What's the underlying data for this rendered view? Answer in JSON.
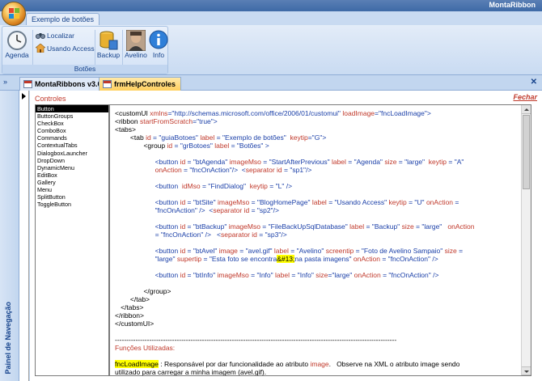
{
  "window": {
    "title": "MontaRibbon"
  },
  "ribbon": {
    "tab_label": "Exemplo de botões",
    "group_label": "Botões",
    "buttons": {
      "agenda": "Agenda",
      "localizar": "Localizar",
      "usando_access": "Usando Access",
      "backup": "Backup",
      "avelino": "Avelino",
      "info": "Info"
    }
  },
  "doc_tabs": {
    "tab1": "MontaRibbons v3.0",
    "tab2": "frmHelpControles"
  },
  "nav_pane": {
    "label": "Painel de Navegação",
    "toggle": "»"
  },
  "form": {
    "controls_title": "Controles",
    "close_link": "Fechar",
    "controls": [
      "Button",
      "ButtonGroups",
      "CheckBox",
      "ComboBox",
      "Commands",
      "ContextualTabs",
      "DialogboxLauncher",
      "DropDown",
      "DynamicMenu",
      "EditBox",
      "Gallery",
      "Menu",
      "SplitButton",
      "ToggleButton"
    ],
    "selected_control": "Button"
  },
  "code": {
    "l1": {
      "a": "<customUI ",
      "b": "xmlns",
      "c": "=\"http://schemas.microsoft.com/office/2006/01/customui\" ",
      "d": "loadImage",
      "e": "=\"fncLoadImage\">"
    },
    "l2": {
      "a": "<ribbon ",
      "b": "startFromScratch",
      "c": "=\"true\">"
    },
    "l3": "<tabs>",
    "l4": {
      "a": "<tab ",
      "b": "id",
      "c": " = \"guiaBotoes\" ",
      "d": "label",
      "e": " = \"Exemplo de botões\"  ",
      "f": "keytip",
      "g": "=\"G\">"
    },
    "l5": {
      "a": "<group ",
      "b": "id",
      "c": " = \"grBotoes\" ",
      "d": "label",
      "e": " = \"Botões\" >"
    },
    "b1a": {
      "a": "<button ",
      "b": "id",
      "c": " = \"btAgenda\" ",
      "d": "imageMso",
      "e": " = \"StartAfterPrevious\" ",
      "f": "label",
      "g": " = \"Agenda\" ",
      "h": "size",
      "i": " = \"large\"  ",
      "j": "keytip",
      "k": " = \"A\""
    },
    "b1b": {
      "a": "onAction",
      "b": " = \"fncOnAction\"/>  <",
      "c": "separator ",
      "d": "id",
      "e": " = \"sp1\"/>"
    },
    "b2": {
      "a": "<button  ",
      "b": "idMso",
      "c": " = \"FindDialog\"  ",
      "d": "keytip",
      "e": " = \"L\" />"
    },
    "b3a": {
      "a": "<button ",
      "b": "id",
      "c": " = \"btSite\" ",
      "d": "imageMso",
      "e": " = \"BlogHomePage\" ",
      "f": "label",
      "g": " = \"Usando Access\" ",
      "h": "keytip",
      "i": " = \"U\" ",
      "j": "onAction",
      "k": " ="
    },
    "b3b": {
      "a": "\"fncOnAction\" />  <",
      "b": "separator ",
      "c": "id",
      "d": " = \"sp2\"/>"
    },
    "b4a": {
      "a": "<button ",
      "b": "id",
      "c": " = \"btBackup\" ",
      "d": "imageMso",
      "e": " = \"FileBackUpSqlDatabase\" ",
      "f": "label",
      "g": " = \"Backup\" ",
      "h": "size",
      "i": " = \"large\"   ",
      "j": "onAction"
    },
    "b4b": {
      "a": "= \"fncOnAction\" />   <",
      "b": "separator ",
      "c": "id",
      "d": " = \"sp3\"/>"
    },
    "b5a": {
      "a": "<button ",
      "b": "id",
      "c": " = \"btAvel\" ",
      "d": "image",
      "e": " = \"avel.gif\" ",
      "f": "label",
      "g": " = \"Avelino\" ",
      "h": "screentip",
      "i": " = \"Foto de Avelino Sampaio\" ",
      "j": "size",
      "k": " ="
    },
    "b5b": {
      "a": "\"large\" ",
      "b": "supertip",
      "c": " = \"Esta foto se encontra",
      "d": "&#13;",
      "e": "na pasta imagens\" ",
      "f": "onAction",
      "g": " = \"fncOnAction\" />"
    },
    "b6": {
      "a": "<button ",
      "b": "id",
      "c": " = \"btInfo\" ",
      "d": "imageMso",
      "e": " = \"Info\" ",
      "f": "label",
      "g": " = \"Info\" ",
      "h": "size",
      "i": "=\"large\" ",
      "j": "onAction",
      "k": " = \"fncOnAction\" />"
    },
    "e1": "</group>",
    "e2": "</tab>",
    "e3": "</tabs>",
    "e4": "</ribbon>",
    "e5": "</customUI>",
    "divider": "---------------------------------------------------------------------------------------------------------------------------",
    "funcs_title": "Funções Utilizadas:",
    "f1": {
      "a": "fncLoadImage",
      "b": " : Responsável por dar funcionalidade ao atributo ",
      "c": "image",
      "d": ".   Observe na XML o atributo image sendo"
    },
    "f2": "utilizado para carregar a minha imagem (avel.gif)."
  }
}
